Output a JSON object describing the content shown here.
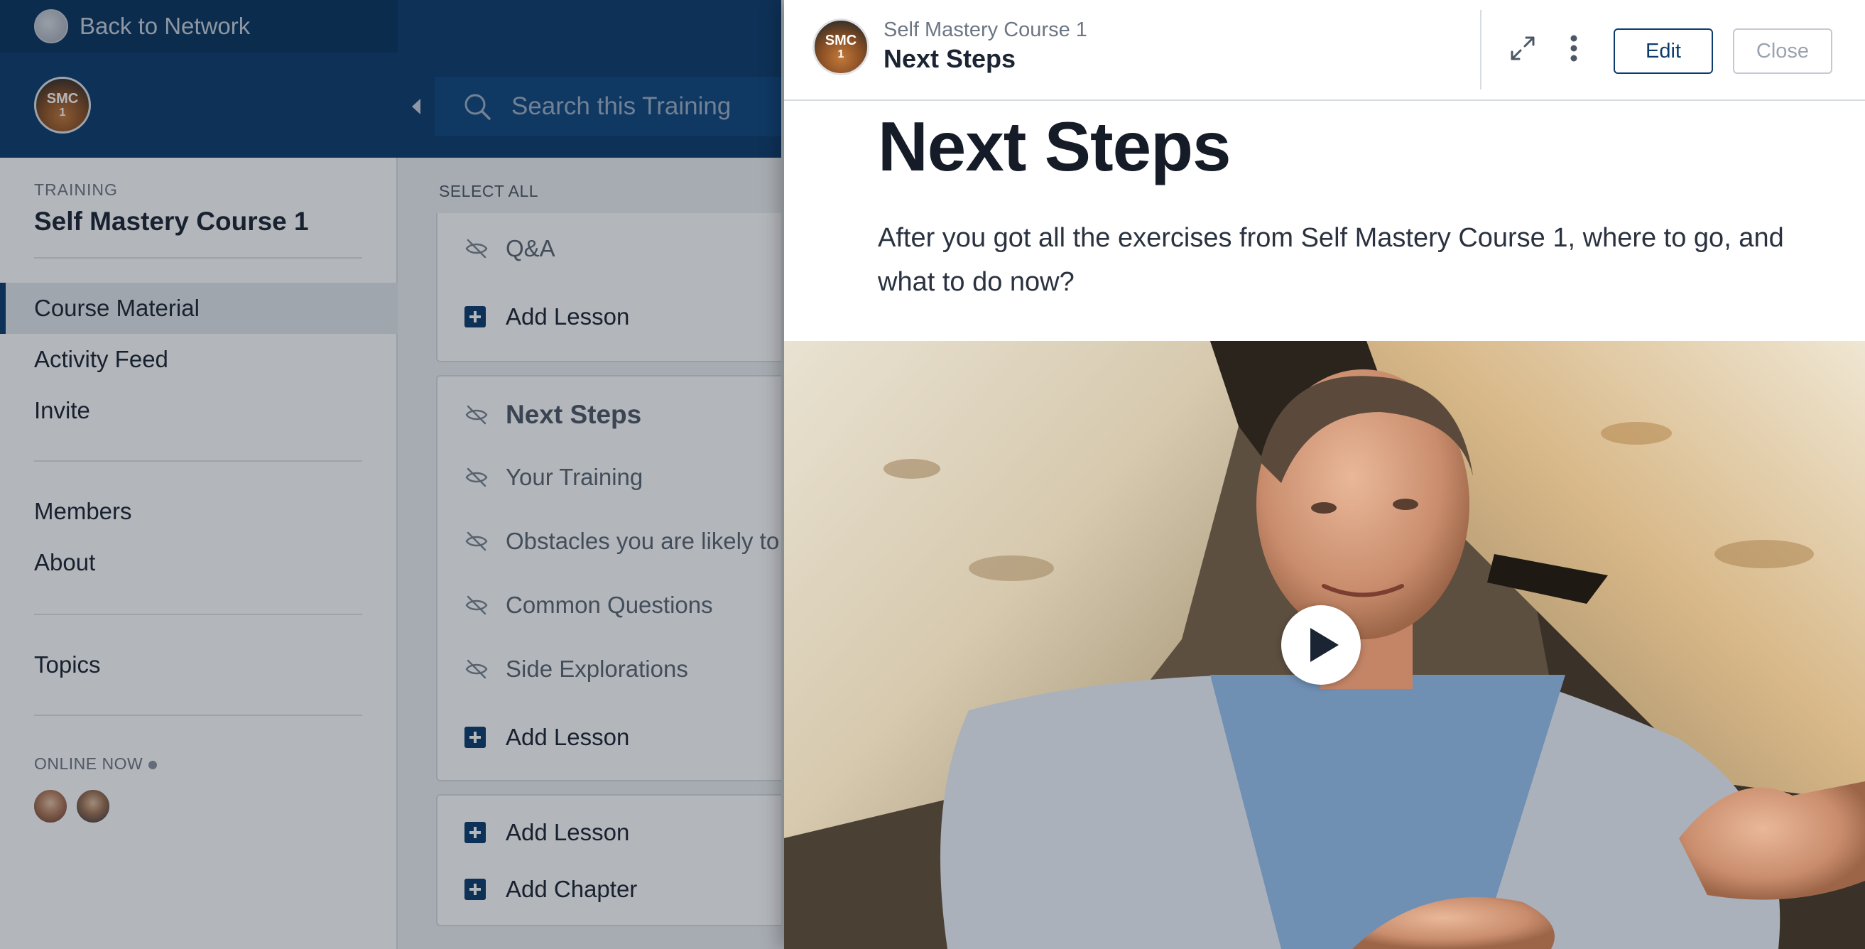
{
  "network": {
    "back_label": "Back to Network"
  },
  "course": {
    "avatar_text": "SMC",
    "avatar_sub": "1"
  },
  "sidebar": {
    "eyebrow": "TRAINING",
    "title": "Self Mastery Course 1",
    "nav_items": [
      {
        "label": "Course Material",
        "active": true
      },
      {
        "label": "Activity Feed"
      },
      {
        "label": "Invite"
      },
      {
        "label": "Members"
      },
      {
        "label": "About"
      },
      {
        "label": "Topics"
      }
    ],
    "online_label": "ONLINE NOW"
  },
  "search": {
    "placeholder": "Search this Training"
  },
  "lesson_list": {
    "select_all": "SELECT ALL",
    "card1": {
      "lesson": "Q&A",
      "add": "Add Lesson"
    },
    "card2": {
      "chapter": "Next Steps",
      "lessons": [
        "Your Training",
        "Obstacles you are likely to",
        "Common Questions",
        "Side Explorations"
      ],
      "add": "Add Lesson"
    },
    "card3": {
      "add_lesson": "Add Lesson",
      "add_chapter": "Add Chapter"
    }
  },
  "panel": {
    "breadcrumb": "Self Mastery Course 1",
    "title": "Next Steps",
    "edit_label": "Edit",
    "close_label": "Close",
    "heading": "Next Steps",
    "description": "After you got all the exercises from Self Mastery Course 1, where to go, and what to do now?"
  },
  "colors": {
    "brand_navy": "#0c3c6e",
    "accent_white": "#ffffff"
  },
  "icons": [
    "network-logo-icon",
    "chevron-left-icon",
    "search-icon",
    "eye-off-icon",
    "plus-icon",
    "expand-icon",
    "more-vertical-icon",
    "play-icon"
  ]
}
